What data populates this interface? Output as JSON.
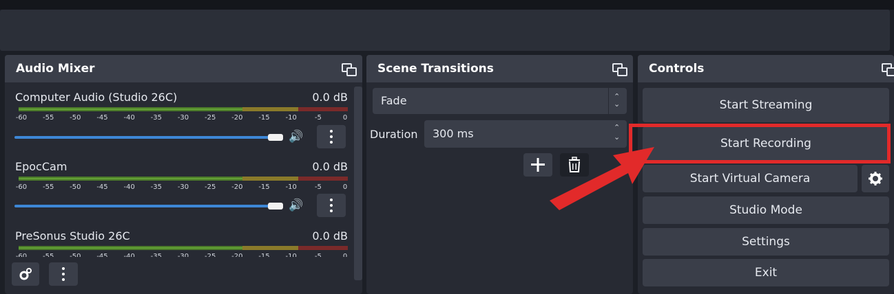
{
  "audio_mixer": {
    "title": "Audio Mixer",
    "channels": [
      {
        "name": "Computer Audio (Studio 26C)",
        "level": "0.0 dB"
      },
      {
        "name": "EpocCam",
        "level": "0.0 dB"
      },
      {
        "name": "PreSonus Studio 26C",
        "level": "0.0 dB"
      }
    ],
    "ticks": [
      "-60",
      "-55",
      "-50",
      "-45",
      "-40",
      "-35",
      "-30",
      "-25",
      "-20",
      "-15",
      "-10",
      "-5",
      "0"
    ]
  },
  "scene_transitions": {
    "title": "Scene Transitions",
    "transition": "Fade",
    "duration_label": "Duration",
    "duration_value": "300 ms"
  },
  "controls": {
    "title": "Controls",
    "start_streaming": "Start Streaming",
    "start_recording": "Start Recording",
    "start_virtual_camera": "Start Virtual Camera",
    "studio_mode": "Studio Mode",
    "settings": "Settings",
    "exit": "Exit"
  },
  "colors": {
    "annotation": "#e22a2a",
    "slider": "#3d87d6"
  }
}
